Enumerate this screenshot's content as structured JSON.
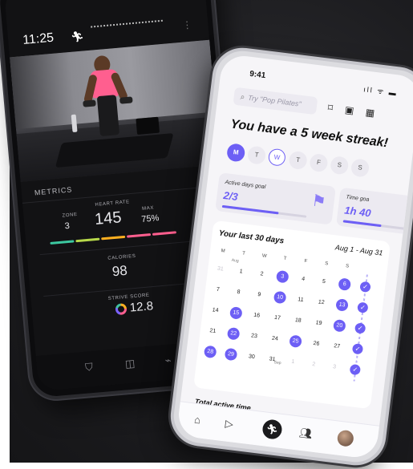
{
  "phone_workout": {
    "time": "11:25",
    "runner_icon": "runner-icon",
    "metrics_title": "METRICS",
    "zone_label": "Zone",
    "zone_value": "3",
    "heart_rate_label": "HEART RATE",
    "heart_rate_value": "145",
    "max_label": "Max",
    "max_value": "75%",
    "calories_label": "CALORIES",
    "calories_value": "98",
    "strive_label": "STRIVE SCORE",
    "strive_value": "12.8",
    "zone_colors": [
      "#3cc8a0",
      "#b6d84a",
      "#ffb020",
      "#ff5f8f",
      "#ff5f8f"
    ]
  },
  "phone_calendar": {
    "time": "9:41",
    "status_icons": "ıll ᯤ ▬",
    "search_placeholder": "Try \"Pop Pilates\"",
    "streak_title": "You have a 5 week streak!",
    "week_days": [
      {
        "label": "M",
        "state": "filled"
      },
      {
        "label": "T",
        "state": "plain"
      },
      {
        "label": "W",
        "state": "ring"
      },
      {
        "label": "T",
        "state": "plain"
      },
      {
        "label": "F",
        "state": "plain"
      },
      {
        "label": "S",
        "state": "plain"
      },
      {
        "label": "S",
        "state": "plain"
      }
    ],
    "active_goal_label": "Active days goal",
    "active_goal_value": "2/3",
    "active_goal_progress": 0.67,
    "time_goal_label": "Time goa",
    "time_goal_value": "1h 40",
    "time_goal_progress": 0.6,
    "calendar_title": "Your last 30 days",
    "calendar_range": "Aug 1 - Aug 31",
    "dow": [
      "M",
      "T",
      "W",
      "T",
      "F",
      "S",
      "S"
    ],
    "month_tag": "Aug",
    "sep_tag": "Sep",
    "weeks": [
      [
        {
          "d": "31",
          "s": "faded"
        },
        {
          "d": "1",
          "s": ""
        },
        {
          "d": "2",
          "s": ""
        },
        {
          "d": "3",
          "s": "on"
        },
        {
          "d": "4",
          "s": ""
        },
        {
          "d": "5",
          "s": ""
        },
        {
          "d": "6",
          "s": "on"
        }
      ],
      [
        {
          "d": "7",
          "s": ""
        },
        {
          "d": "8",
          "s": ""
        },
        {
          "d": "9",
          "s": ""
        },
        {
          "d": "10",
          "s": "on"
        },
        {
          "d": "11",
          "s": ""
        },
        {
          "d": "12",
          "s": ""
        },
        {
          "d": "13",
          "s": "on"
        }
      ],
      [
        {
          "d": "14",
          "s": ""
        },
        {
          "d": "15",
          "s": "on"
        },
        {
          "d": "16",
          "s": ""
        },
        {
          "d": "17",
          "s": ""
        },
        {
          "d": "18",
          "s": ""
        },
        {
          "d": "19",
          "s": ""
        },
        {
          "d": "20",
          "s": "on"
        }
      ],
      [
        {
          "d": "21",
          "s": ""
        },
        {
          "d": "22",
          "s": "on"
        },
        {
          "d": "23",
          "s": ""
        },
        {
          "d": "24",
          "s": ""
        },
        {
          "d": "25",
          "s": "on"
        },
        {
          "d": "26",
          "s": ""
        },
        {
          "d": "27",
          "s": ""
        }
      ],
      [
        {
          "d": "28",
          "s": "on"
        },
        {
          "d": "29",
          "s": "on"
        },
        {
          "d": "30",
          "s": ""
        },
        {
          "d": "31",
          "s": ""
        },
        {
          "d": "1",
          "s": "faded"
        },
        {
          "d": "2",
          "s": "faded"
        },
        {
          "d": "3",
          "s": "faded"
        }
      ]
    ],
    "checkmark": "✓",
    "total_label": "Total active time",
    "nav_icons": [
      "home-icon",
      "play-icon",
      "runner-icon",
      "community-icon",
      "avatar"
    ]
  }
}
